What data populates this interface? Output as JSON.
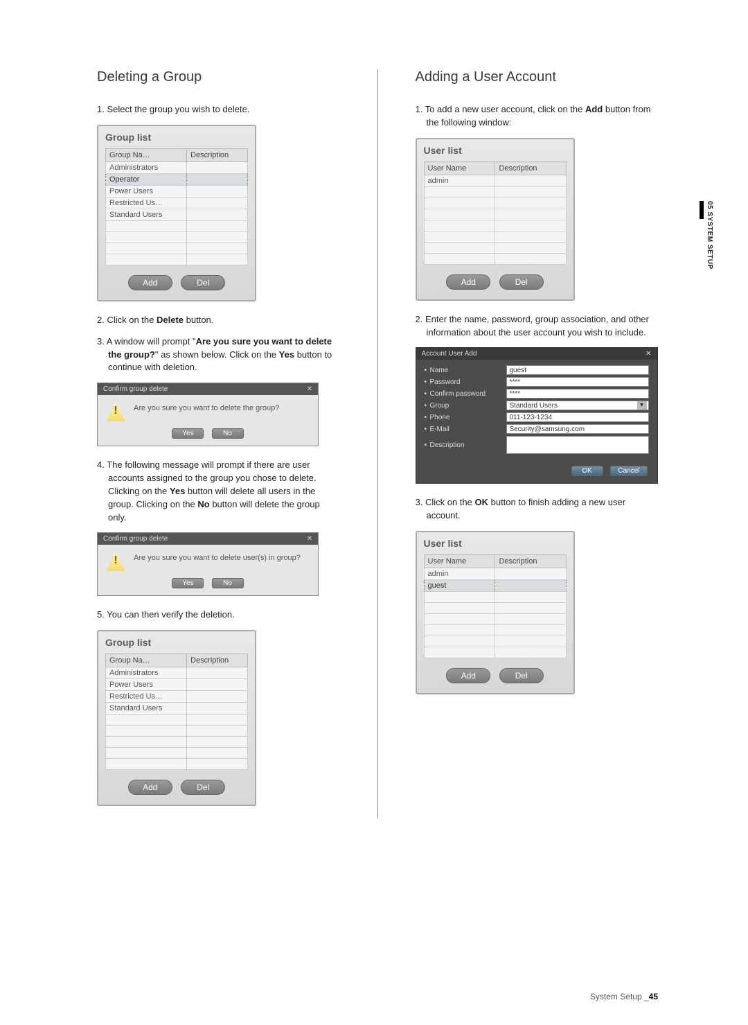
{
  "side_tab": "05 SYSTEM SETUP",
  "footer": {
    "label": "System Setup _",
    "page": "45"
  },
  "left": {
    "heading": "Deleting a Group",
    "step1": "1. Select the group you wish to delete.",
    "step2_a": "2. Click on the ",
    "step2_b": "Delete",
    "step2_c": " button.",
    "step3_a": "3. A window will prompt \"",
    "step3_b": "Are you sure you want to delete the group?",
    "step3_c": "\" as shown below. Click on the ",
    "step3_d": "Yes",
    "step3_e": " button to continue with deletion.",
    "step4_a": "4. The following message will prompt if there are user accounts assigned to the group you chose to delete. Clicking on the ",
    "step4_b": "Yes",
    "step4_c": " button will delete all users in the group. Clicking on the ",
    "step4_d": "No",
    "step4_e": " button will delete the group only.",
    "step5": "5. You can then verify the deletion.",
    "group_panel": {
      "title": "Group list",
      "col1": "Group Na…",
      "col2": "Description",
      "rows_before": [
        "Administrators",
        "Operator",
        "Power Users",
        "Restricted Us…",
        "Standard Users"
      ],
      "rows_after": [
        "Administrators",
        "Power Users",
        "Restricted Us…",
        "Standard Users"
      ],
      "add": "Add",
      "del": "Del"
    },
    "dialog1": {
      "title": "Confirm group delete",
      "msg": "Are you sure you want to delete the group?",
      "yes": "Yes",
      "no": "No"
    },
    "dialog2": {
      "title": "Confirm group delete",
      "msg": "Are you sure you want to delete user(s) in group?",
      "yes": "Yes",
      "no": "No"
    }
  },
  "right": {
    "heading": "Adding a User Account",
    "step1_a": "1. To add a new user account, click on the ",
    "step1_b": "Add",
    "step1_c": " button from the following window:",
    "step2": "2. Enter the name, password, group association, and other information about the user account you wish to include.",
    "step3_a": "3. Click on the ",
    "step3_b": "OK",
    "step3_c": " button to finish adding a new user account.",
    "user_panel": {
      "title": "User list",
      "col1": "User Name",
      "col2": "Description",
      "rows_before": [
        "admin"
      ],
      "rows_after": [
        "admin",
        "guest"
      ],
      "add": "Add",
      "del": "Del"
    },
    "form": {
      "title": "Account User Add",
      "fields": {
        "name_lbl": "Name",
        "name_val": "guest",
        "pw_lbl": "Password",
        "pw_val": "****",
        "cpw_lbl": "Confirm password",
        "cpw_val": "****",
        "group_lbl": "Group",
        "group_val": "Standard Users",
        "phone_lbl": "Phone",
        "phone_val": "011-123-1234",
        "email_lbl": "E-Mail",
        "email_val": "Security@samsung.com",
        "desc_lbl": "Description",
        "desc_val": ""
      },
      "ok": "OK",
      "cancel": "Cancel"
    }
  }
}
